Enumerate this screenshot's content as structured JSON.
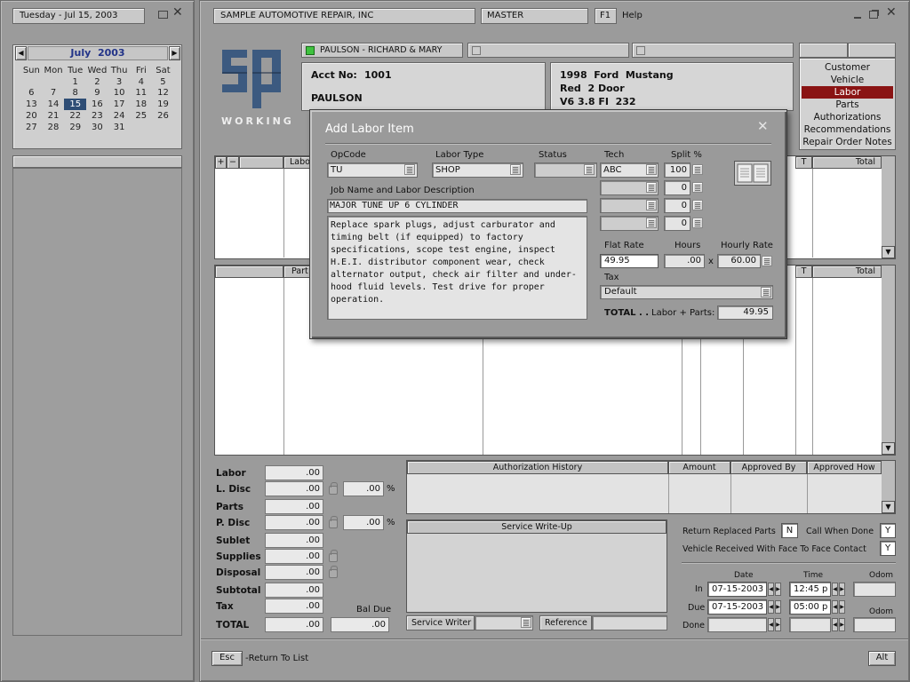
{
  "left": {
    "date_label": "Tuesday - Jul 15, 2003",
    "calendar": {
      "month": "July",
      "year": "2003",
      "weekdays": [
        "Sun",
        "Mon",
        "Tue",
        "Wed",
        "Thu",
        "Fri",
        "Sat"
      ],
      "weeks": [
        [
          "",
          "",
          "1",
          "2",
          "3",
          "4",
          "5"
        ],
        [
          "6",
          "7",
          "8",
          "9",
          "10",
          "11",
          "12"
        ],
        [
          "13",
          "14",
          "15",
          "16",
          "17",
          "18",
          "19"
        ],
        [
          "20",
          "21",
          "22",
          "23",
          "24",
          "25",
          "26"
        ],
        [
          "27",
          "28",
          "29",
          "30",
          "31",
          "",
          ""
        ]
      ],
      "selected": "15"
    }
  },
  "top": {
    "company": "SAMPLE AUTOMOTIVE REPAIR, INC",
    "db": "MASTER",
    "f1": "F1",
    "help": "Help"
  },
  "logo": {
    "status": "WORKING"
  },
  "customer": {
    "name_tab": "PAULSON - RICHARD & MARY",
    "acct_label": "Acct No:",
    "acct_no": "1001",
    "last_name": "PAULSON"
  },
  "vehicle": {
    "line1": "1998  Ford  Mustang",
    "line2": "Red  2 Door",
    "line3": "V6 3.8 FI  232"
  },
  "sidemenu": [
    "Customer",
    "Vehicle",
    "Labor",
    "Parts",
    "Authorizations",
    "Recommendations",
    "Repair Order Notes"
  ],
  "sidemenu_active": "Labor",
  "labor_grid": {
    "add": "+",
    "remove": "−",
    "col_labor": "Labo",
    "col_t": "T",
    "col_total": "Total"
  },
  "parts_grid": {
    "col_parts": "Part",
    "col_t": "T",
    "col_total": "Total"
  },
  "dialog": {
    "title": "Add Labor Item",
    "opcode_label": "OpCode",
    "opcode": "TU",
    "labortype_label": "Labor Type",
    "labortype": "SHOP",
    "status_label": "Status",
    "status": "",
    "job_label": "Job Name and Labor Description",
    "job_name": "MAJOR TUNE UP 6 CYLINDER",
    "description": "Replace spark plugs, adjust carburator and timing belt (if equipped) to factory specifications, scope test engine, inspect H.E.I. distributor component wear, check alternator output, check air filter and under-hood fluid levels. Test drive for proper operation.",
    "tech_label": "Tech",
    "split_label": "Split %",
    "techs": [
      {
        "tech": "ABC",
        "split": "100"
      },
      {
        "tech": "",
        "split": "0"
      },
      {
        "tech": "",
        "split": "0"
      },
      {
        "tech": "",
        "split": "0"
      }
    ],
    "flatrate_label": "Flat Rate",
    "flatrate": "49.95",
    "hours_label": "Hours",
    "hours": ".00",
    "x": "x",
    "hourly_label": "Hourly Rate",
    "hourly": "60.00",
    "tax_label": "Tax",
    "tax": "Default",
    "total_label": "TOTAL . .",
    "total_sub": "Labor + Parts:",
    "total": "49.95"
  },
  "summary": [
    {
      "label": "Labor",
      "value": ".00"
    },
    {
      "label": "L. Disc",
      "value": ".00",
      "pct": ".00",
      "pct_sign": "%"
    },
    {
      "label": "Parts",
      "value": ".00"
    },
    {
      "label": "P. Disc",
      "value": ".00",
      "pct": ".00",
      "pct_sign": "%"
    },
    {
      "label": "Sublet",
      "value": ".00"
    },
    {
      "label": "Supplies",
      "value": ".00"
    },
    {
      "label": "Disposal",
      "value": ".00"
    },
    {
      "label": "Subtotal",
      "value": ".00"
    },
    {
      "label": "Tax",
      "value": ".00"
    }
  ],
  "total": {
    "label": "TOTAL",
    "value": ".00",
    "baldue_label": "Bal Due",
    "baldue": ".00"
  },
  "auth": {
    "cols": [
      "Authorization  History",
      "Amount",
      "Approved By",
      "Approved How"
    ]
  },
  "writeup": {
    "title": "Service  Write-Up",
    "writer_label": "Service Writer",
    "reference_label": "Reference"
  },
  "flags": {
    "return_label": "Return Replaced Parts",
    "return_val": "N",
    "call_label": "Call When Done",
    "call_val": "Y",
    "f2f_label": "Vehicle Received With Face To Face Contact",
    "f2f_val": "Y"
  },
  "schedule": {
    "date_label": "Date",
    "time_label": "Time",
    "odom_label": "Odom",
    "in_label": "In",
    "in_date": "07-15-2003",
    "in_time": "12:45 p",
    "due_label": "Due",
    "due_date": "07-15-2003",
    "due_time": "05:00 p",
    "done_label": "Done",
    "odom2_label": "Odom"
  },
  "footer": {
    "esc": "Esc",
    "esc_text": "-Return To List",
    "alt": "Alt"
  }
}
